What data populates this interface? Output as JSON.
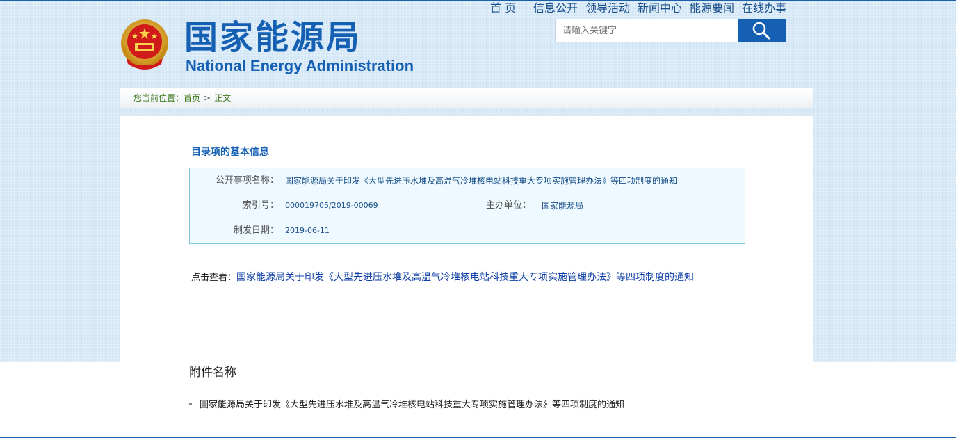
{
  "header": {
    "site_title_cn": "国家能源局",
    "site_title_en": "National Energy Administration",
    "search_placeholder": "请输入关键字",
    "nav": [
      "首 页",
      "信息公开",
      "领导活动",
      "新闻中心",
      "能源要闻",
      "在线办事"
    ]
  },
  "breadcrumb": {
    "prefix": "您当前位置：",
    "home": "首页",
    "separator": ">",
    "current": "正文"
  },
  "info": {
    "section_title": "目录项的基本信息",
    "name_label": "公开事项名称：",
    "name_value": "国家能源局关于印发《大型先进压水堆及高温气冷堆核电站科技重大专项实施管理办法》等四项制度的通知",
    "index_label": "索引号：",
    "index_value": "000019705/2019-00069",
    "org_label": "主办单位：",
    "org_value": "国家能源局",
    "date_label": "制发日期：",
    "date_value": "2019-06-11"
  },
  "view": {
    "label": "点击查看：",
    "link": "国家能源局关于印发《大型先进压水堆及高温气冷堆核电站科技重大专项实施管理办法》等四项制度的通知"
  },
  "attachments": {
    "title": "附件名称",
    "items": [
      "国家能源局关于印发《大型先进压水堆及高温气冷堆核电站科技重大专项实施管理办法》等四项制度的通知"
    ]
  },
  "colors": {
    "brand_blue": "#1560b3",
    "info_bg": "#eefaff",
    "crumb_green": "#3d7a1f"
  }
}
